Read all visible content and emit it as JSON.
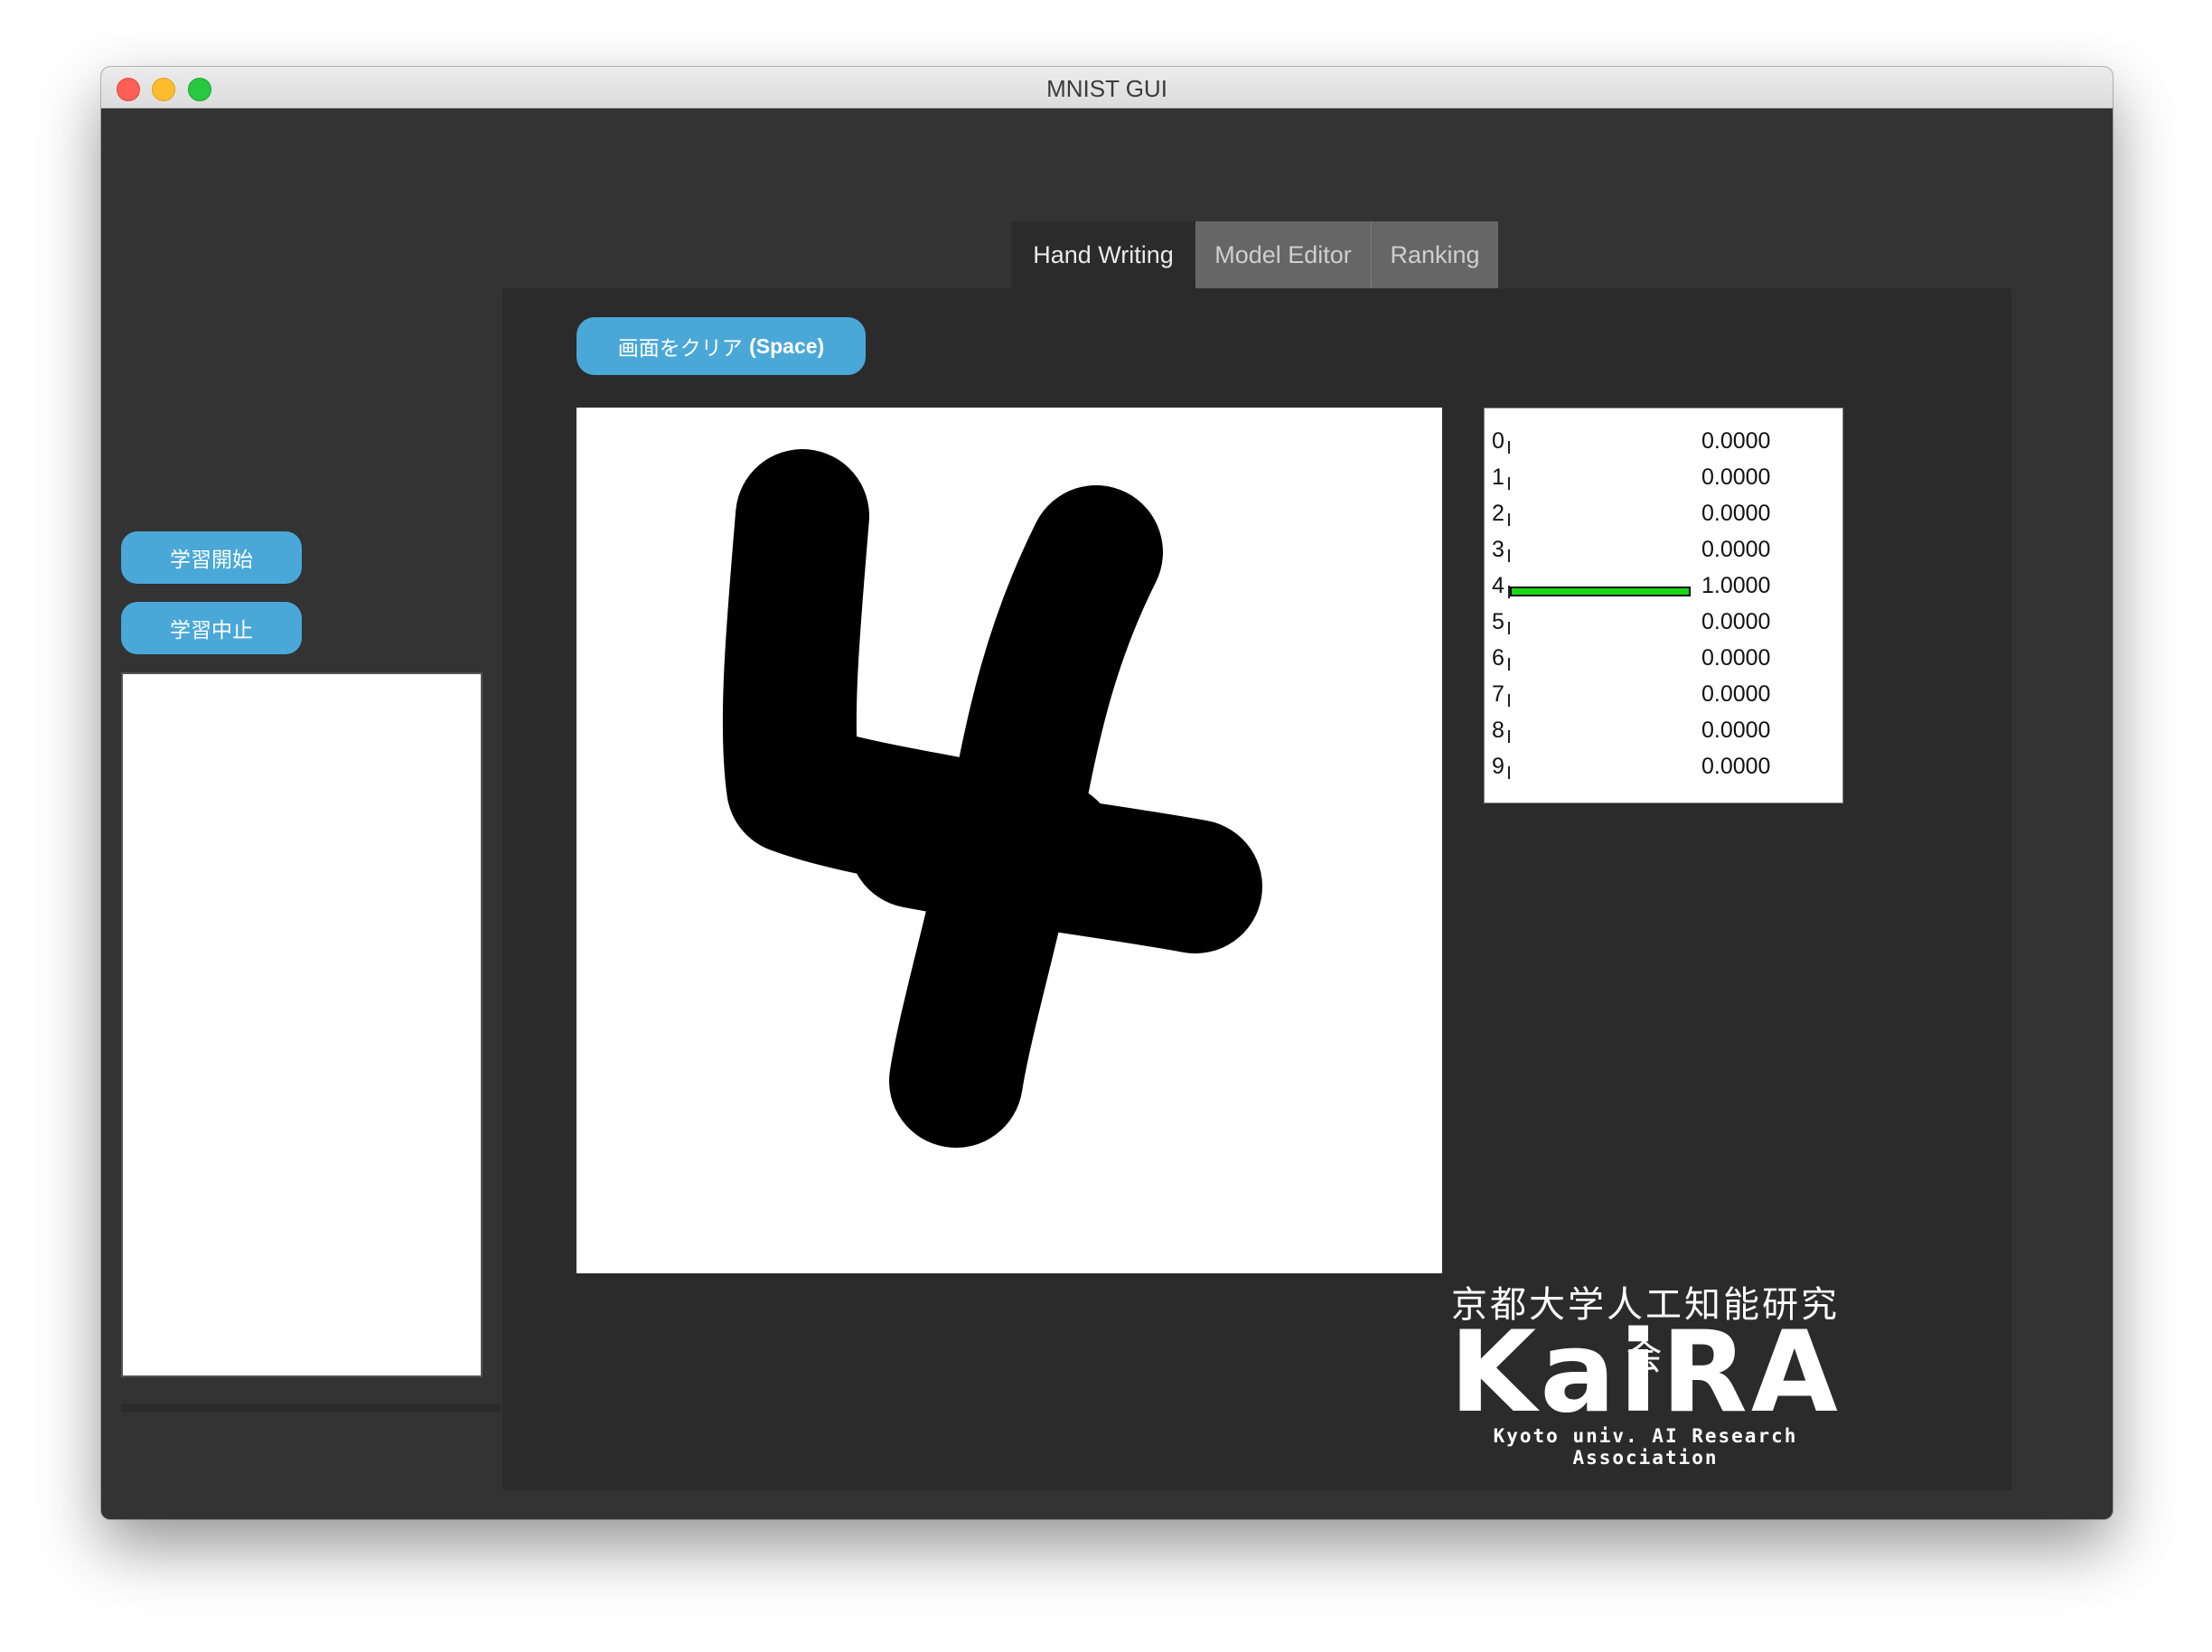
{
  "window": {
    "title": "MNIST GUI"
  },
  "left": {
    "start_label": "学習開始",
    "stop_label": "学習中止"
  },
  "tabs": [
    {
      "label": "Hand Writing",
      "active": true
    },
    {
      "label": "Model Editor",
      "active": false
    },
    {
      "label": "Ranking",
      "active": false
    }
  ],
  "hand_writing": {
    "clear_label_jp": "画面をクリア",
    "clear_label_key": "(Space)",
    "predictions": [
      {
        "digit": "0",
        "prob": 0.0,
        "value": "0.0000"
      },
      {
        "digit": "1",
        "prob": 0.0,
        "value": "0.0000"
      },
      {
        "digit": "2",
        "prob": 0.0,
        "value": "0.0000"
      },
      {
        "digit": "3",
        "prob": 0.0,
        "value": "0.0000"
      },
      {
        "digit": "4",
        "prob": 1.0,
        "value": "1.0000"
      },
      {
        "digit": "5",
        "prob": 0.0,
        "value": "0.0000"
      },
      {
        "digit": "6",
        "prob": 0.0,
        "value": "0.0000"
      },
      {
        "digit": "7",
        "prob": 0.0,
        "value": "0.0000"
      },
      {
        "digit": "8",
        "prob": 0.0,
        "value": "0.0000"
      },
      {
        "digit": "9",
        "prob": 0.0,
        "value": "0.0000"
      }
    ]
  },
  "logo": {
    "jp": "京都大学人工知能研究会",
    "main": "KaiRA",
    "sub": "Kyoto univ. AI Research Association"
  },
  "colors": {
    "accent": "#4aa8d8",
    "bar": "#16d916",
    "background": "#333333",
    "panel": "#2b2b2b"
  }
}
